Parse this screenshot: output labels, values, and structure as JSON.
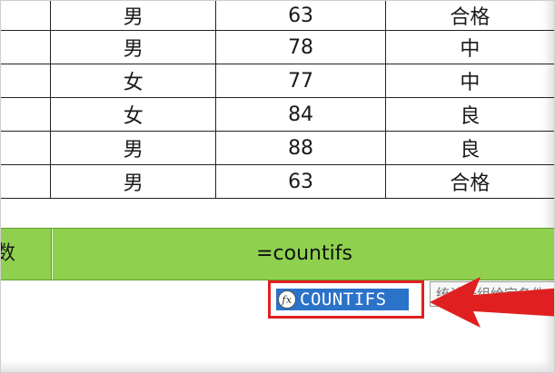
{
  "table": {
    "rows": [
      {
        "gender": "男",
        "score": "63",
        "grade": "合格"
      },
      {
        "gender": "男",
        "score": "78",
        "grade": "中"
      },
      {
        "gender": "女",
        "score": "77",
        "grade": "中"
      },
      {
        "gender": "女",
        "score": "84",
        "grade": "良"
      },
      {
        "gender": "男",
        "score": "88",
        "grade": "良"
      },
      {
        "gender": "男",
        "score": "63",
        "grade": "合格"
      }
    ]
  },
  "formula_row": {
    "label": "数",
    "formula": "=countifs"
  },
  "autocomplete": {
    "icon": "fx-icon",
    "suggestion": "COUNTIFS",
    "tooltip": "统计一组给定条件"
  },
  "colors": {
    "green_row": "#8fd14f",
    "selection": "#2b72c9",
    "highlight_box": "#e02020"
  }
}
